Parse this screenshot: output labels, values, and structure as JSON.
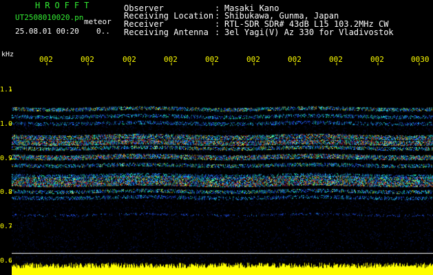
{
  "header": {
    "title": "HROFFT",
    "filename": "UT2508010020.pn",
    "meteor_label": "meteor",
    "datetime": "25.08.01 00:20",
    "status_dots": "0..",
    "meta": [
      {
        "label": "Observer",
        "sep": ":",
        "value": "Masaki Kano"
      },
      {
        "label": "Receiving Location",
        "sep": ":",
        "value": "Shibukawa, Gunma, Japan"
      },
      {
        "label": "Receiver",
        "sep": ":",
        "value": "RTL-SDR SDR# 43dB L15 103.2MHz CW"
      },
      {
        "label": "Receiving Antenna",
        "sep": ":",
        "value": "3el Yagi(V) Az 330 for Vladivostok"
      }
    ]
  },
  "axis": {
    "y_unit": "kHz",
    "y_ticks": [
      "1.1",
      "1.0",
      "0.9",
      "0.8",
      "0.7",
      "0.6"
    ],
    "x_ticks": [
      "002",
      "002",
      "002",
      "002",
      "002",
      "002",
      "002",
      "002",
      "002",
      "0030"
    ]
  },
  "colors": {
    "background": "#000000",
    "text_white": "#ffffff",
    "text_green": "#33ee33",
    "labels": "#ffff00",
    "noise_floor": "#0a1a66",
    "band_blue": "#2255ff",
    "band_cyan": "#22ddff",
    "band_hot": "#ff3322",
    "amplitude": "#ffff00"
  }
}
